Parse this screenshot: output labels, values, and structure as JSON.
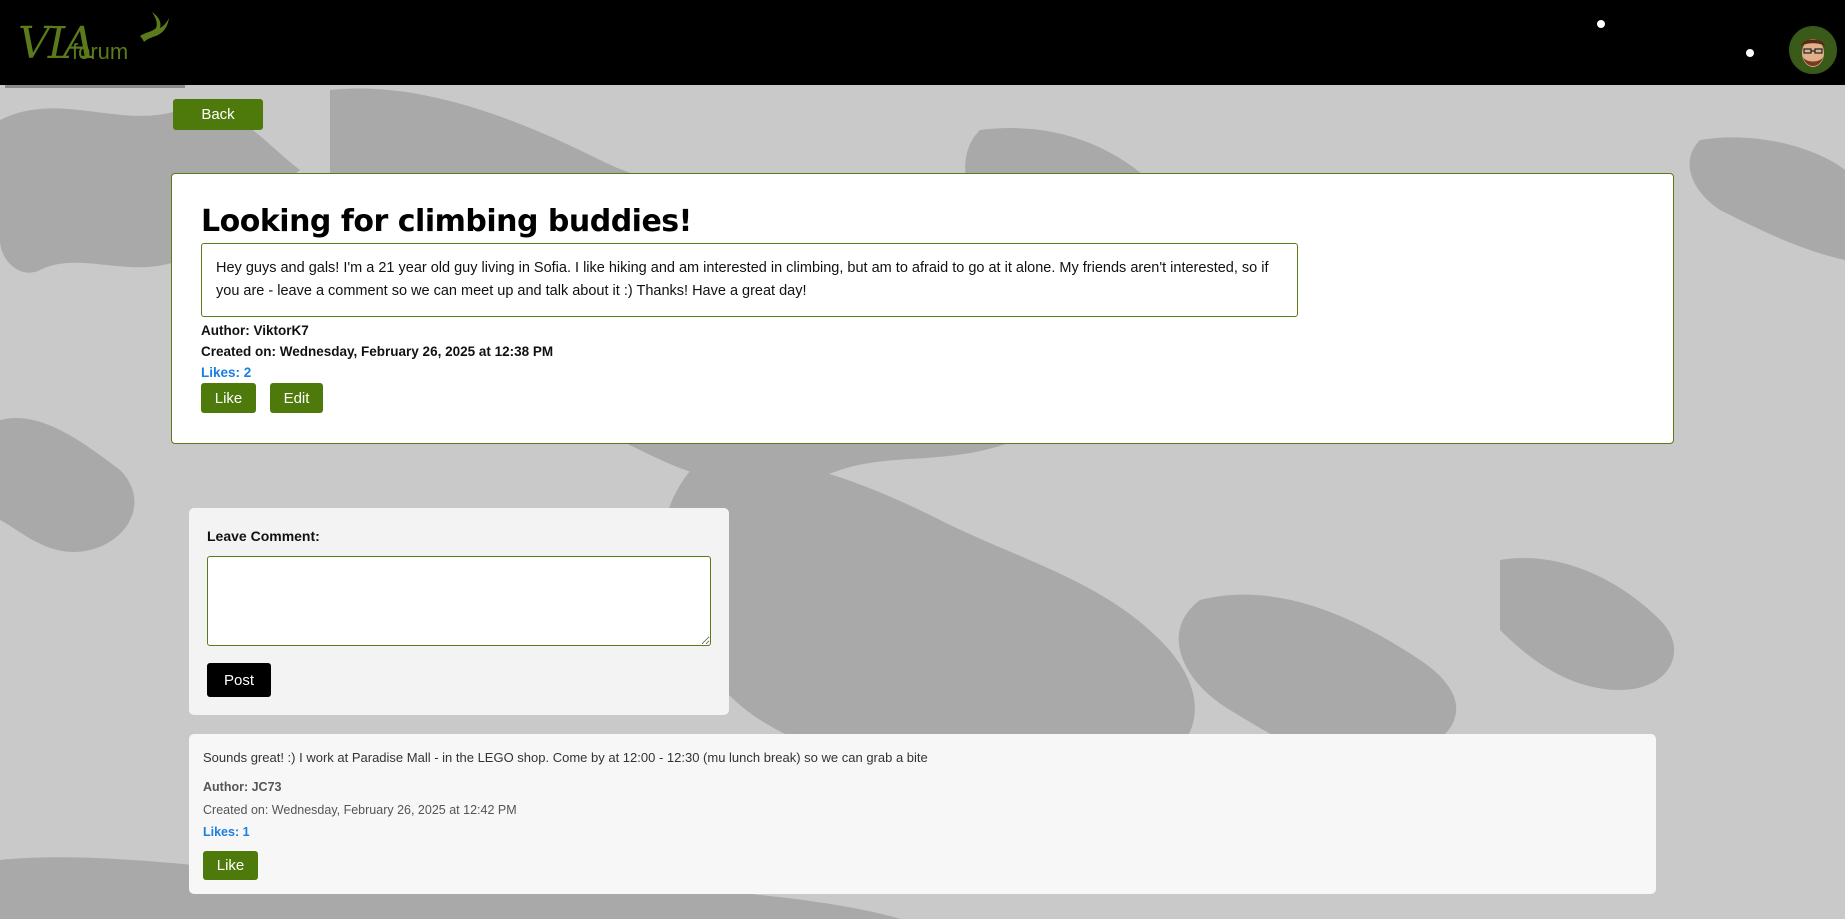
{
  "header": {
    "logo_text": "VIA",
    "logo_subtext": "forum"
  },
  "nav": {
    "back_label": "Back"
  },
  "post": {
    "title": "Looking for climbing buddies!",
    "body": "Hey guys and gals! I'm a 21 year old guy living in Sofia. I like hiking and am interested in climbing, but am to afraid to go at it alone. My friends aren't interested, so if you are - leave a comment so we can meet up and talk about it :) Thanks! Have a great day!",
    "author": "Author: ViktorK7",
    "created": "Created on: Wednesday, February 26, 2025 at 12:38 PM",
    "likes": "Likes: 2",
    "like_label": "Like",
    "edit_label": "Edit"
  },
  "comment_form": {
    "label": "Leave Comment:",
    "value": "",
    "post_label": "Post"
  },
  "comments": [
    {
      "text": "Sounds great! :) I work at Paradise Mall - in the LEGO shop. Come by at 12:00 - 12:30 (mu lunch break) so we can grab a bite",
      "author": "Author: JC73",
      "created": "Created on: Wednesday, February 26, 2025 at 12:42 PM",
      "likes": "Likes: 1",
      "like_label": "Like"
    }
  ],
  "colors": {
    "accent": "#4e7a0c",
    "header_bg": "#000000",
    "likes": "#1a7fe0",
    "page_bg": "#c9c9c9"
  },
  "icons": {
    "logo_bird": "bird-icon",
    "avatar": "user-avatar"
  }
}
